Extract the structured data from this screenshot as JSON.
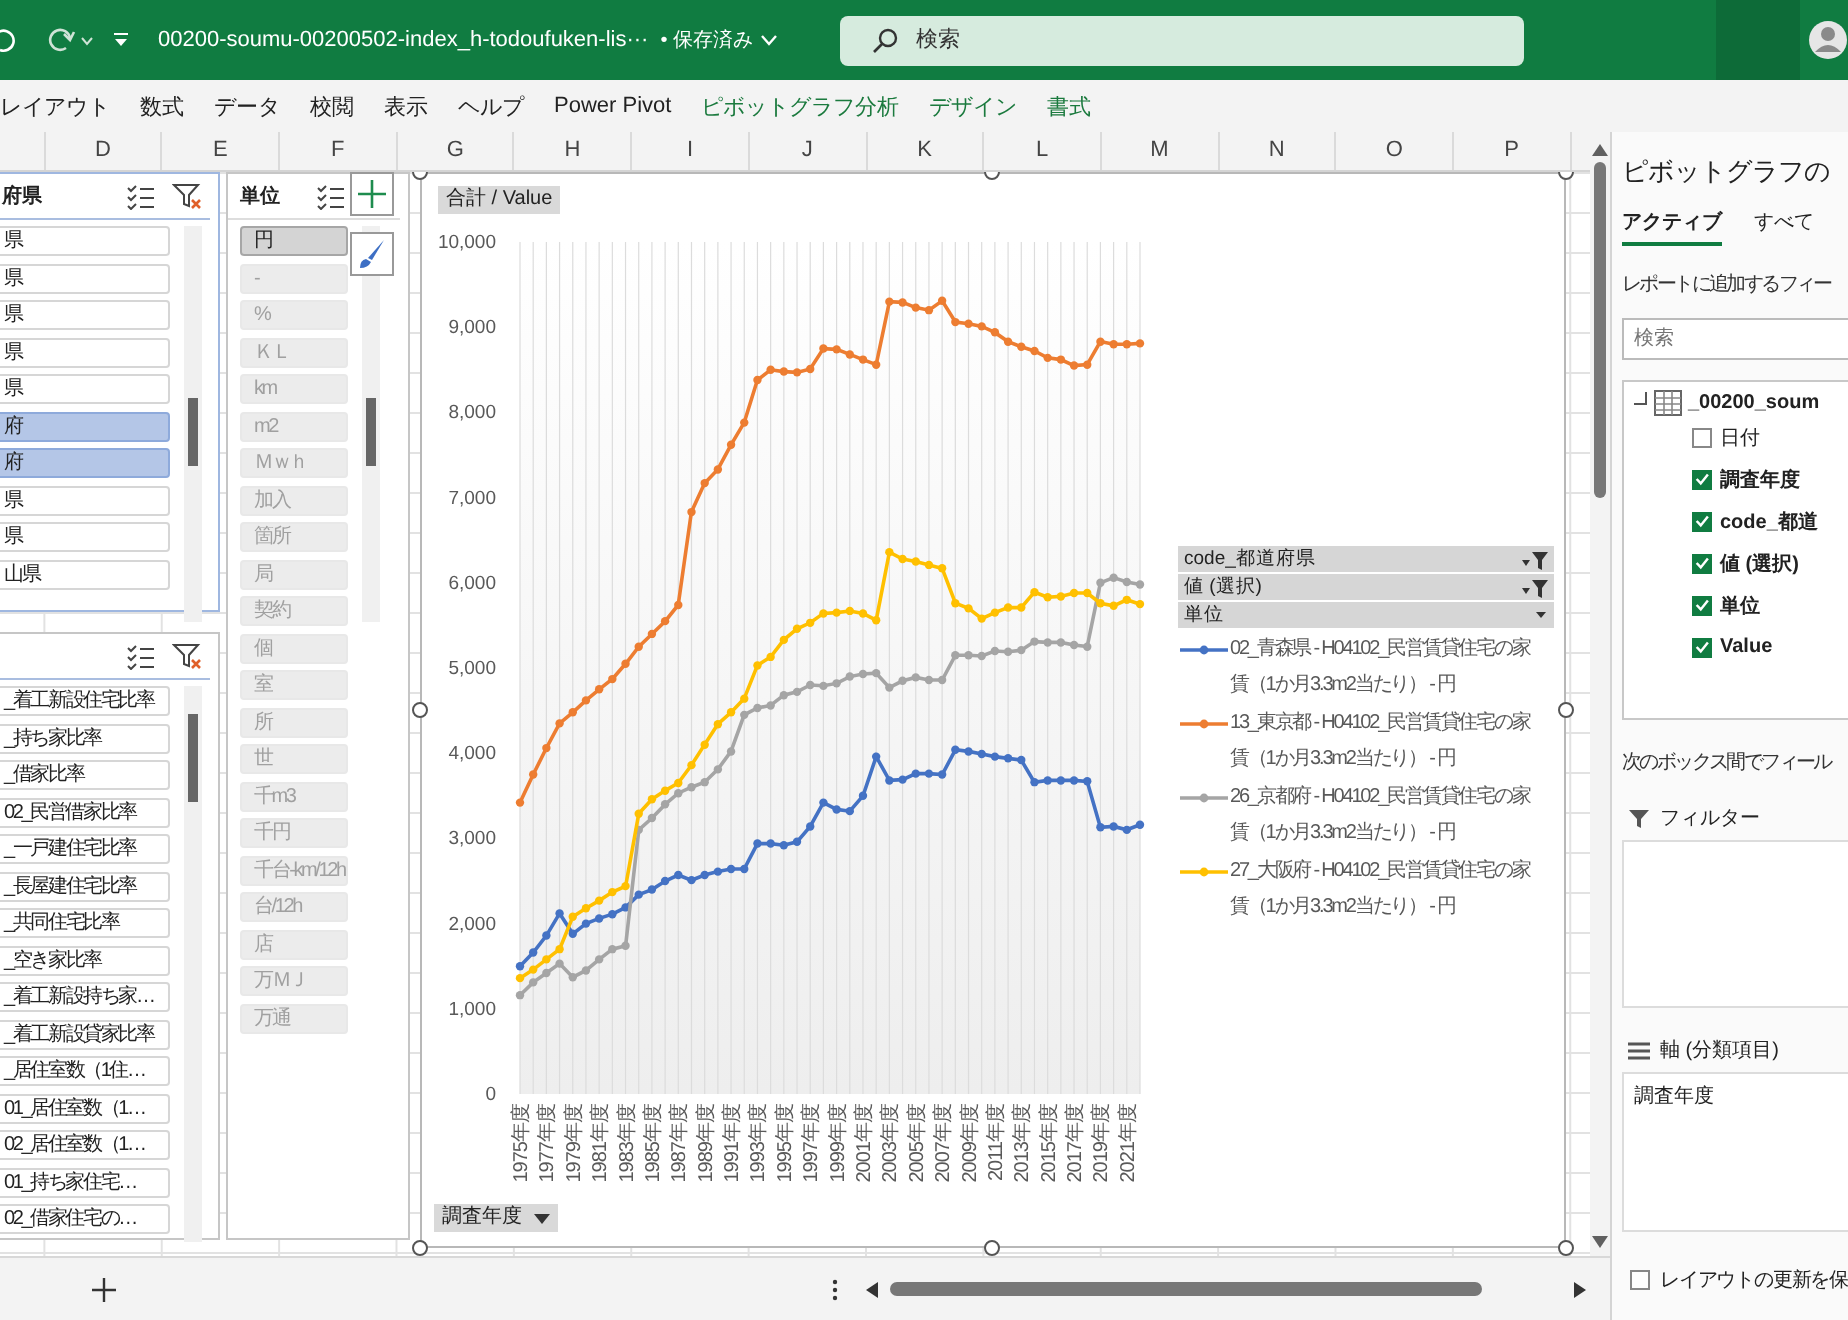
{
  "title_bar": {
    "file_name": "00200-soumu-00200502-index_h-todoufuken-lis···",
    "save_status": "• 保存済み",
    "search": {
      "placeholder": "検索"
    }
  },
  "ribbon_tabs": [
    {
      "label": "レイアウト",
      "kind": "normal"
    },
    {
      "label": "数式",
      "kind": "normal"
    },
    {
      "label": "データ",
      "kind": "normal"
    },
    {
      "label": "校閲",
      "kind": "normal"
    },
    {
      "label": "表示",
      "kind": "normal"
    },
    {
      "label": "ヘルプ",
      "kind": "normal"
    },
    {
      "label": "Power Pivot",
      "kind": "normal"
    },
    {
      "label": "ピボットグラフ分析",
      "kind": "contextual"
    },
    {
      "label": "デザイン",
      "kind": "contextual"
    },
    {
      "label": "書式",
      "kind": "contextual"
    }
  ],
  "column_headers": [
    "D",
    "E",
    "F",
    "G",
    "H",
    "I",
    "J",
    "K",
    "L",
    "M",
    "N",
    "O",
    "P"
  ],
  "slicers": [
    {
      "title": "府県",
      "filtered": true,
      "items": [
        {
          "label": "県",
          "selected": false,
          "available": true
        },
        {
          "label": "県",
          "selected": false,
          "available": true
        },
        {
          "label": "県",
          "selected": false,
          "available": true
        },
        {
          "label": "県",
          "selected": false,
          "available": true
        },
        {
          "label": "県",
          "selected": false,
          "available": true
        },
        {
          "label": "府",
          "selected": true,
          "available": true
        },
        {
          "label": "府",
          "selected": true,
          "available": true
        },
        {
          "label": "県",
          "selected": false,
          "available": true
        },
        {
          "label": "県",
          "selected": false,
          "available": true
        },
        {
          "label": "山県",
          "selected": false,
          "available": true
        }
      ]
    },
    {
      "filtered": true,
      "items": [
        {
          "label": "_着工新設住宅比率",
          "selected": false,
          "available": true
        },
        {
          "label": "_持ち家比率",
          "selected": false,
          "available": true
        },
        {
          "label": "_借家比率",
          "selected": false,
          "available": true
        },
        {
          "label": "02_民営借家比率",
          "selected": false,
          "available": true
        },
        {
          "label": "_一戸建住宅比率",
          "selected": false,
          "available": true
        },
        {
          "label": "_長屋建住宅比率",
          "selected": false,
          "available": true
        },
        {
          "label": "_共同住宅比率",
          "selected": false,
          "available": true
        },
        {
          "label": "_空き家比率",
          "selected": false,
          "available": true
        },
        {
          "label": "_着工新設持ち家…",
          "selected": false,
          "available": true
        },
        {
          "label": "_着工新設貸家比率",
          "selected": false,
          "available": true
        },
        {
          "label": "_居住室数（1住…",
          "selected": false,
          "available": true
        },
        {
          "label": "01_居住室数（1…",
          "selected": false,
          "available": true
        },
        {
          "label": "02_居住室数（1…",
          "selected": false,
          "available": true
        },
        {
          "label": "01_持ち家住宅…",
          "selected": false,
          "available": true
        },
        {
          "label": "02_借家住宅の…",
          "selected": false,
          "available": true
        }
      ]
    },
    {
      "title": "単位",
      "filtered": false,
      "items": [
        {
          "label": "円",
          "selected": true,
          "available": true
        },
        {
          "label": "-",
          "selected": false,
          "available": false
        },
        {
          "label": "%",
          "selected": false,
          "available": false
        },
        {
          "label": "ＫＬ",
          "selected": false,
          "available": false
        },
        {
          "label": "km",
          "selected": false,
          "available": false
        },
        {
          "label": "m2",
          "selected": false,
          "available": false
        },
        {
          "label": "Ｍｗｈ",
          "selected": false,
          "available": false
        },
        {
          "label": "加入",
          "selected": false,
          "available": false
        },
        {
          "label": "箇所",
          "selected": false,
          "available": false
        },
        {
          "label": "局",
          "selected": false,
          "available": false
        },
        {
          "label": "契約",
          "selected": false,
          "available": false
        },
        {
          "label": "個",
          "selected": false,
          "available": false
        },
        {
          "label": "室",
          "selected": false,
          "available": false
        },
        {
          "label": "所",
          "selected": false,
          "available": false
        },
        {
          "label": "世",
          "selected": false,
          "available": false
        },
        {
          "label": "千m3",
          "selected": false,
          "available": false
        },
        {
          "label": "千円",
          "selected": false,
          "available": false
        },
        {
          "label": "千台-km/12h",
          "selected": false,
          "available": false
        },
        {
          "label": "台/12h",
          "selected": false,
          "available": false
        },
        {
          "label": "店",
          "selected": false,
          "available": false
        },
        {
          "label": "万ＭＪ",
          "selected": false,
          "available": false
        },
        {
          "label": "万通",
          "selected": false,
          "available": false
        }
      ]
    }
  ],
  "chart": {
    "value_field": "合計 / Value",
    "axis_field": "調査年度",
    "legend_fields": [
      {
        "label": "code_都道府県",
        "filtered": true
      },
      {
        "label": "値 (選択)",
        "filtered": true
      },
      {
        "label": "単位",
        "filtered": false
      }
    ],
    "chart_data": {
      "type": "line",
      "x": [
        1975,
        1976,
        1977,
        1978,
        1979,
        1980,
        1981,
        1982,
        1983,
        1984,
        1985,
        1986,
        1987,
        1988,
        1989,
        1990,
        1991,
        1992,
        1993,
        1994,
        1995,
        1996,
        1997,
        1998,
        1999,
        2000,
        2001,
        2002,
        2003,
        2004,
        2005,
        2006,
        2007,
        2008,
        2009,
        2010,
        2011,
        2012,
        2013,
        2014,
        2015,
        2016,
        2017,
        2018,
        2019,
        2020,
        2021,
        2022
      ],
      "xticks": [
        {
          "value": 1975,
          "label": "1975年度"
        },
        {
          "value": 1977,
          "label": "1977年度"
        },
        {
          "value": 1979,
          "label": "1979年度"
        },
        {
          "value": 1981,
          "label": "1981年度"
        },
        {
          "value": 1983,
          "label": "1983年度"
        },
        {
          "value": 1985,
          "label": "1985年度"
        },
        {
          "value": 1987,
          "label": "1987年度"
        },
        {
          "value": 1989,
          "label": "1989年度"
        },
        {
          "value": 1991,
          "label": "1991年度"
        },
        {
          "value": 1993,
          "label": "1993年度"
        },
        {
          "value": 1995,
          "label": "1995年度"
        },
        {
          "value": 1997,
          "label": "1997年度"
        },
        {
          "value": 1999,
          "label": "1999年度"
        },
        {
          "value": 2001,
          "label": "2001年度"
        },
        {
          "value": 2003,
          "label": "2003年度"
        },
        {
          "value": 2005,
          "label": "2005年度"
        },
        {
          "value": 2007,
          "label": "2007年度"
        },
        {
          "value": 2009,
          "label": "2009年度"
        },
        {
          "value": 2011,
          "label": "2011年度"
        },
        {
          "value": 2013,
          "label": "2013年度"
        },
        {
          "value": 2015,
          "label": "2015年度"
        },
        {
          "value": 2017,
          "label": "2017年度"
        },
        {
          "value": 2019,
          "label": "2019年度"
        },
        {
          "value": 2021,
          "label": "2021年度"
        }
      ],
      "xlim": [
        1975,
        2022
      ],
      "grid": {
        "x": true,
        "y": false
      },
      "ylim": [
        0,
        10000
      ],
      "yticks": [
        {
          "value": 0,
          "label": "0"
        },
        {
          "value": 1000,
          "label": "1,000"
        },
        {
          "value": 2000,
          "label": "2,000"
        },
        {
          "value": 3000,
          "label": "3,000"
        },
        {
          "value": 4000,
          "label": "4,000"
        },
        {
          "value": 5000,
          "label": "5,000"
        },
        {
          "value": 6000,
          "label": "6,000"
        },
        {
          "value": 7000,
          "label": "7,000"
        },
        {
          "value": 8000,
          "label": "8,000"
        },
        {
          "value": 9000,
          "label": "9,000"
        },
        {
          "value": 10000,
          "label": "10,000"
        }
      ],
      "series": [
        {
          "name": "02_青森県 - H04102_民営賃貸住宅の家賃（1か月3.3m2当たり） - 円",
          "color": "#4472c4",
          "marker": "circle",
          "values": [
            1500,
            1660,
            1860,
            2120,
            1880,
            2000,
            2060,
            2110,
            2190,
            2340,
            2400,
            2500,
            2570,
            2510,
            2570,
            2610,
            2640,
            2640,
            2940,
            2940,
            2920,
            2960,
            3140,
            3420,
            3340,
            3320,
            3500,
            3960,
            3680,
            3690,
            3760,
            3760,
            3750,
            4040,
            4020,
            3990,
            3960,
            3940,
            3920,
            3660,
            3680,
            3680,
            3680,
            3670,
            3130,
            3140,
            3100,
            3160
          ]
        },
        {
          "name": "13_東京都 - H04102_民営賃貸住宅の家賃（1か月3.3m2当たり） - 円",
          "color": "#ed7d31",
          "marker": "circle",
          "values": [
            3420,
            3750,
            4060,
            4350,
            4480,
            4620,
            4750,
            4870,
            5050,
            5250,
            5400,
            5550,
            5740,
            6830,
            7170,
            7330,
            7620,
            7880,
            8380,
            8500,
            8480,
            8470,
            8510,
            8750,
            8740,
            8680,
            8620,
            8560,
            9300,
            9290,
            9230,
            9200,
            9310,
            9060,
            9040,
            9010,
            8940,
            8830,
            8770,
            8720,
            8640,
            8620,
            8550,
            8560,
            8830,
            8800,
            8800,
            8810
          ]
        },
        {
          "name": "26_京都府 - H04102_民営賃貸住宅の家賃（1か月3.3m2当たり） - 円",
          "color": "#a5a5a5",
          "marker": "circle",
          "values": [
            1160,
            1310,
            1420,
            1530,
            1370,
            1450,
            1580,
            1700,
            1740,
            3100,
            3240,
            3400,
            3530,
            3600,
            3660,
            3810,
            4020,
            4450,
            4530,
            4560,
            4680,
            4720,
            4800,
            4790,
            4820,
            4900,
            4930,
            4940,
            4770,
            4850,
            4890,
            4860,
            4860,
            5150,
            5150,
            5140,
            5200,
            5190,
            5210,
            5310,
            5300,
            5300,
            5270,
            5250,
            6000,
            6060,
            6010,
            5980
          ]
        },
        {
          "name": "27_大阪府 - H04102_民営賃貸住宅の家賃（1か月3.3m2当たり） - 円",
          "color": "#ffc000",
          "marker": "circle",
          "values": [
            1360,
            1460,
            1580,
            1700,
            2080,
            2180,
            2270,
            2370,
            2440,
            3290,
            3460,
            3560,
            3650,
            3860,
            4100,
            4340,
            4480,
            4640,
            5030,
            5130,
            5330,
            5460,
            5530,
            5640,
            5650,
            5670,
            5640,
            5560,
            6360,
            6280,
            6250,
            6210,
            6170,
            5760,
            5700,
            5580,
            5650,
            5710,
            5710,
            5890,
            5830,
            5840,
            5880,
            5880,
            5760,
            5730,
            5800,
            5750
          ]
        }
      ]
    }
  },
  "field_pane": {
    "title": "ピボットグラフの",
    "tabs": [
      {
        "label": "アクティブ",
        "selected": true
      },
      {
        "label": "すべて",
        "selected": false
      }
    ],
    "hint": "レポートに追加するフィー",
    "search": {
      "placeholder": "検索"
    },
    "table": {
      "name": "_00200_soum",
      "fields": [
        {
          "label": "日付",
          "checked": false
        },
        {
          "label": "調査年度",
          "checked": true
        },
        {
          "label": "code_都道",
          "checked": true
        },
        {
          "label": "値 (選択)",
          "checked": true
        },
        {
          "label": "単位",
          "checked": true
        },
        {
          "label": "Value",
          "checked": true
        }
      ]
    },
    "areas_hint": "次のボックス間でフィール",
    "areas": [
      {
        "kind": "filter",
        "label": "フィルター"
      },
      {
        "kind": "axis",
        "label": "軸 (分類項目)",
        "items": [
          "調査年度"
        ]
      }
    ],
    "defer_update": {
      "label": "レイアウトの更新を保",
      "checked": false
    }
  }
}
